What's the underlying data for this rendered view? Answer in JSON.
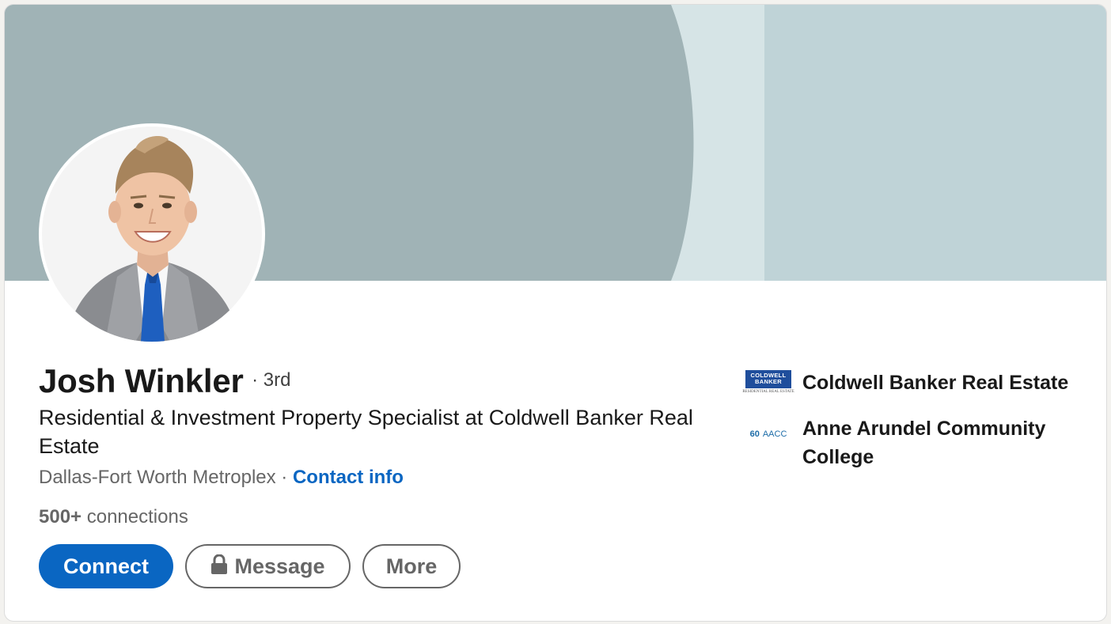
{
  "profile": {
    "name": "Josh Winkler",
    "degree": "· 3rd",
    "headline": "Residential & Investment Property Specialist at Coldwell Banker Real Estate",
    "location": "Dallas-Fort Worth Metroplex",
    "separator": " · ",
    "contact_label": "Contact info",
    "connections_count": "500+",
    "connections_label": " connections"
  },
  "actions": {
    "connect_label": "Connect",
    "message_label": "Message",
    "more_label": "More"
  },
  "sidebar": {
    "items": [
      {
        "label": "Coldwell Banker Real Estate",
        "logo_line1": "COLDWELL",
        "logo_line2": "BANKER",
        "logo_sub": "RESIDENTIAL REAL ESTATE"
      },
      {
        "label": "Anne Arundel Community College",
        "logo_num": "60",
        "logo_text": "AACC"
      }
    ]
  },
  "colors": {
    "accent": "#0a66c2",
    "banner_dark": "#a0b3b6",
    "banner_light": "#d6e4e6",
    "banner_mid": "#bfd3d7"
  },
  "icons": {
    "message": "lock-icon"
  }
}
